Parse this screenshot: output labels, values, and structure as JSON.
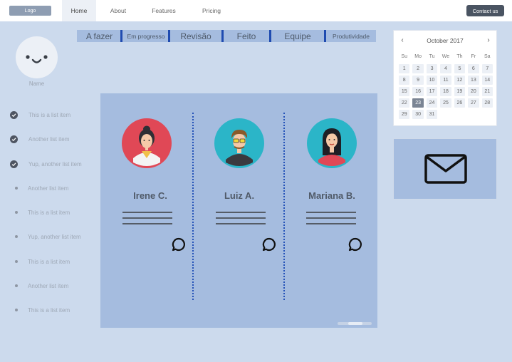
{
  "nav": {
    "logo": "Logo",
    "items": [
      "Home",
      "About",
      "Features",
      "Pricing"
    ],
    "active": "Home",
    "contact": "Contact us"
  },
  "profile": {
    "name": "Name"
  },
  "sidebar": {
    "items": [
      {
        "label": "This is a list item",
        "checked": true
      },
      {
        "label": "Another list item",
        "checked": true
      },
      {
        "label": "Yup, another list item",
        "checked": true
      },
      {
        "label": "Another list item",
        "checked": false
      },
      {
        "label": "This is a list item",
        "checked": false
      },
      {
        "label": "Yup, another list item",
        "checked": false
      },
      {
        "label": "This is a list item",
        "checked": false
      },
      {
        "label": "Another list item",
        "checked": false
      },
      {
        "label": "This is a list item",
        "checked": false
      }
    ]
  },
  "tabs": [
    "A fazer",
    "Em progresso",
    "Revisão",
    "Feito",
    "Equipe",
    "Produtividade"
  ],
  "team": [
    {
      "name": "Irene C.",
      "color": "#e04856"
    },
    {
      "name": "Luiz A.",
      "color": "#2bb5c8"
    },
    {
      "name": "Mariana B.",
      "color": "#2bb5c8"
    }
  ],
  "calendar": {
    "month": "October 2017",
    "weekdays": [
      "Su",
      "Mo",
      "Tu",
      "We",
      "Th",
      "Fr",
      "Sa"
    ],
    "days": [
      "1",
      "2",
      "3",
      "4",
      "5",
      "6",
      "7",
      "8",
      "9",
      "10",
      "11",
      "12",
      "13",
      "14",
      "15",
      "16",
      "17",
      "18",
      "19",
      "20",
      "21",
      "22",
      "23",
      "24",
      "25",
      "26",
      "27",
      "28",
      "29",
      "30",
      "31"
    ],
    "selected": "23"
  },
  "icons": {
    "prev": "chevron-left-icon",
    "next": "chevron-right-icon",
    "mail": "envelope-icon",
    "comment": "chat-bubble-icon",
    "check": "check-circle-icon"
  }
}
